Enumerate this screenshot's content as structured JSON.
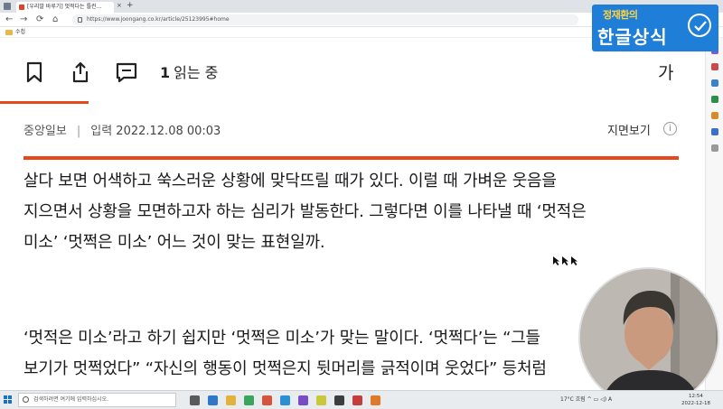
{
  "browser": {
    "tab_title": "[우리말 바루기] 멋적다는 틀린...",
    "tab_close": "×",
    "tab_new": "+",
    "url": "https://www.joongang.co.kr/article/25123995#home",
    "bookmark_folder": "수첩",
    "back": "←",
    "forward": "→",
    "reload": "⟳",
    "home": "⌂"
  },
  "toolbar": {
    "reader_count": "1",
    "reader_label": "읽는 중",
    "font_size_label": "가"
  },
  "article": {
    "publisher": "중앙일보",
    "separator": "|",
    "input_label": "입력",
    "date": "2022.12.08 00:03",
    "edition_label": "지면보기",
    "info_glyph": "i",
    "paragraph1": [
      "살다 보면 어색하고 쑥스러운 상황에 맞닥뜨릴 때가 있다. 이럴 때 가벼운 웃음을",
      "지으면서 상황을 모면하고자 하는 심리가 발동한다. 그렇다면 이를 나타낼 때 ‘멋적은",
      "미소’ ‘멋쩍은 미소’ 어느 것이 맞는 표현일까."
    ],
    "paragraph2": [
      "‘멋적은 미소’라고 하기 쉽지만 ‘멋쩍은 미소’가 맞는 말이다. ‘멋쩍다’는 “그들",
      "보기가 멋쩍었다” “자신의 행동이 멋쩍은지 뒷머리를 긁적이며 웃었다” 등처럼"
    ]
  },
  "logo": {
    "name": "정재환의",
    "title": "한글상식"
  },
  "taskbar": {
    "search_placeholder": "검색하려면 여기에 입력하십시오.",
    "weather": "17°C 흐림  ^  ▭  ◁)  A",
    "time": "12:54",
    "date": "2022-12-18"
  },
  "colors": {
    "accent": "#e8461b",
    "logo_bg": "#1f7fd8",
    "logo_name": "#ffd23f"
  }
}
